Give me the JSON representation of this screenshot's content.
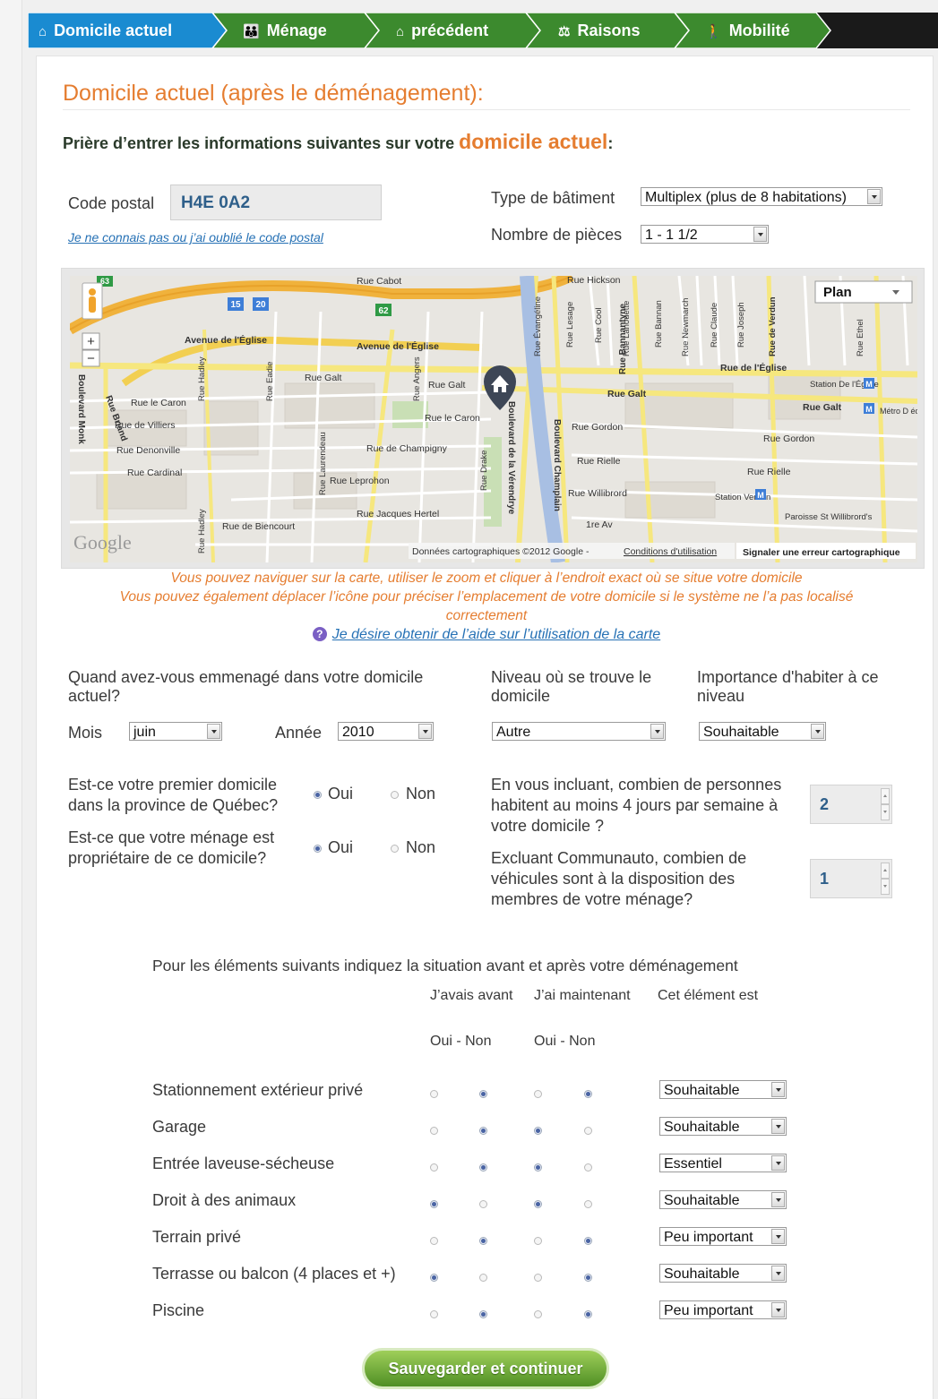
{
  "nav": {
    "items": [
      {
        "label": "Domicile actuel",
        "icon": "home-icon",
        "active": true
      },
      {
        "label": "Ménage",
        "icon": "family-icon",
        "active": false
      },
      {
        "label": "précédent",
        "icon": "home-icon",
        "active": false
      },
      {
        "label": "Raisons",
        "icon": "scales-icon",
        "active": false
      },
      {
        "label": "Mobilité",
        "icon": "walker-icon",
        "active": false
      }
    ],
    "active_color": "#1a8bd1",
    "item_color": "#3c8a2e"
  },
  "heading": "Domicile actuel (après le déménagement):",
  "intro": {
    "before": "Prière d’entrer les informations suivantes sur votre ",
    "highlight": "domicile actuel",
    "after": ":"
  },
  "postal": {
    "label": "Code postal",
    "value": "H4E 0A2",
    "forgot_link": "Je ne connais pas ou j’ai oublié le code postal"
  },
  "building": {
    "label": "Type de bâtiment",
    "value": "Multiplex (plus de 8 habitations)"
  },
  "rooms": {
    "label": "Nombre de pièces",
    "value": "1 - 1 1/2"
  },
  "map": {
    "map_type": "Plan",
    "zoom_in": "+",
    "zoom_out": "−",
    "attribution": "Données cartographiques ©2012 Google - ",
    "terms": "Conditions d'utilisation",
    "report": "Signaler une erreur cartographique",
    "google": "Google",
    "labels": {
      "avenue_eglise": "Avenue de l'Église",
      "rue_cabot": "Rue Cabot",
      "rue_hickson": "Rue Hickson",
      "rue_galt": "Rue Galt",
      "rue_le_caron": "Rue le Caron",
      "rue_de_villiers": "Rue de Villiers",
      "rue_denonville": "Rue Denonville",
      "rue_cardinal": "Rue Cardinal",
      "rue_leprohon": "Rue Leprohon",
      "rue_de_champigny": "Rue de Champigny",
      "rue_jacques_hertel": "Rue Jacques Hertel",
      "rue_de_biencourt": "Rue de Biencourt",
      "rue_gordon": "Rue Gordon",
      "rue_rielle": "Rue Rielle",
      "rue_willibrord": "Rue Willibrord",
      "premiere_av": "1re Av",
      "rue_de_leglise": "Rue de l'Église",
      "station_eglise": "Station De l'Église",
      "station_verdun": "Station Verdun",
      "paroisse": "Paroisse St Willibrord's",
      "metro_edicule": "Métro D édicule",
      "boulevard_monk": "Boulevard Monk",
      "boulevard_briand": "Rue Briand",
      "boulevard_verendrye": "Boulevard de la Vérendrye",
      "boulevard_champlain": "Boulevard Champlain",
      "rue_drake": "Rue Drake",
      "rue_hadley": "Rue Hadley",
      "rue_eadie": "Rue Eadie",
      "rue_angers": "Rue Angers",
      "rue_laurendeau": "Rue Laurendeau",
      "rue_bannantyne": "Rue Bannantyne",
      "rue_evangeline": "Rue Évangéline",
      "rue_lesage": "Rue Lesage",
      "rue_cool": "Rue Cool",
      "rue_lanouette": "Rue Lanouette",
      "rue_bannan": "Rue Bannan",
      "rue_newmarch": "Rue Newmarch",
      "rue_claude": "Rue Claude",
      "rue_joseph": "Rue Joseph",
      "rue_de_verdun": "Rue de Verdun",
      "rue_ethel": "Rue Ethel",
      "hwy_15": "15",
      "hwy_20": "20",
      "hwy_62": "62",
      "hwy_63": "63"
    }
  },
  "map_help": {
    "line1": "Vous pouvez naviguer sur la carte, utiliser le zoom et cliquer à l’endroit exact où se situe votre domicile",
    "line2": "Vous pouvez également déplacer l’icône pour préciser l’emplacement de votre domicile si le système ne l’a pas localisé",
    "line3": "correctement",
    "link": "Je désire obtenir de l’aide sur l’utilisation de la carte"
  },
  "move_in": {
    "question_l1": "Quand avez-vous emmenagé dans votre domicile",
    "question_l2": "actuel?",
    "month_label": "Mois",
    "month_value": "juin",
    "year_label": "Année",
    "year_value": "2010"
  },
  "level": {
    "label_l1": "Niveau où se trouve le",
    "label_l2": "domicile",
    "value": "Autre"
  },
  "level_importance": {
    "label_l1": "Importance d'habiter à ce",
    "label_l2": "niveau",
    "value": "Souhaitable"
  },
  "first_home": {
    "q1": "Est-ce votre premier domicile",
    "q2": "dans la province de Québec?",
    "yes": "Oui",
    "no": "Non",
    "selected": "Oui"
  },
  "owner": {
    "q1": "Est-ce que votre ménage est",
    "q2": "propriétaire de ce domicile?",
    "yes": "Oui",
    "no": "Non",
    "selected": "Oui"
  },
  "persons": {
    "q1": "En vous incluant, combien de personnes",
    "q2": "habitent au moins 4 jours par semaine à",
    "q3": "votre domicile ?",
    "value": "2"
  },
  "vehicles": {
    "q1": "Excluant Communauto, combien de",
    "q2": "véhicules sont à la disposition des",
    "q3": "membres de votre ménage?",
    "value": "1"
  },
  "table": {
    "title": "Pour les éléments suivants indiquez la situation avant et après votre déménagement",
    "col_before": "J’avais avant",
    "col_now": "J’ai maintenant",
    "col_importance": "Cet élément est",
    "yes_no_before": "Oui - Non",
    "yes_no_now": "Oui - Non",
    "rows": [
      {
        "label": "Stationnement extérieur privé",
        "before": "Non",
        "now": "Non",
        "importance": "Souhaitable"
      },
      {
        "label": "Garage",
        "before": "Non",
        "now": "Oui",
        "importance": "Souhaitable"
      },
      {
        "label": "Entrée laveuse-sécheuse",
        "before": "Non",
        "now": "Oui",
        "importance": "Essentiel"
      },
      {
        "label": "Droit à des animaux",
        "before": "Oui",
        "now": "Oui",
        "importance": "Souhaitable"
      },
      {
        "label": "Terrain privé",
        "before": "Non",
        "now": "Non",
        "importance": "Peu important"
      },
      {
        "label": "Terrasse ou balcon (4 places et +)",
        "before": "Oui",
        "now": "Non",
        "importance": "Souhaitable"
      },
      {
        "label": "Piscine",
        "before": "Non",
        "now": "Non",
        "importance": "Peu important"
      }
    ]
  },
  "save_button": "Sauvegarder et continuer"
}
